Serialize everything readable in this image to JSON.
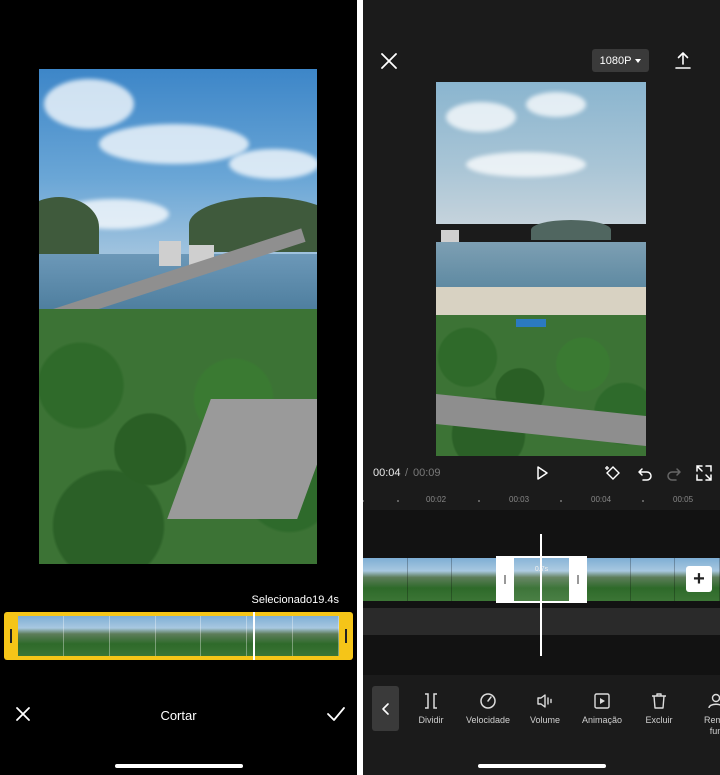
{
  "left_screen": {
    "selected_label": "Selecionado19.4s",
    "title": "Cortar",
    "thumbnail_count": 7
  },
  "right_screen": {
    "resolution": "1080P",
    "time_current": "00:04",
    "time_separator": "/",
    "time_total": "00:09",
    "ruler_labels": [
      "00:02",
      "00:03",
      "00:04",
      "00:05"
    ],
    "selected_clip_duration": "0.7s",
    "tools": [
      {
        "label": "Dividir",
        "icon": "split-icon"
      },
      {
        "label": "Velocidade",
        "icon": "speed-icon"
      },
      {
        "label": "Volume",
        "icon": "volume-icon"
      },
      {
        "label": "Animação",
        "icon": "animation-icon"
      },
      {
        "label": "Excluir",
        "icon": "trash-icon"
      },
      {
        "label": "Remo\nfun",
        "icon": "person-icon"
      }
    ]
  },
  "colors": {
    "trim_accent": "#f5c518",
    "panel_dark": "#1b1b1b",
    "left_bg": "#000000"
  }
}
